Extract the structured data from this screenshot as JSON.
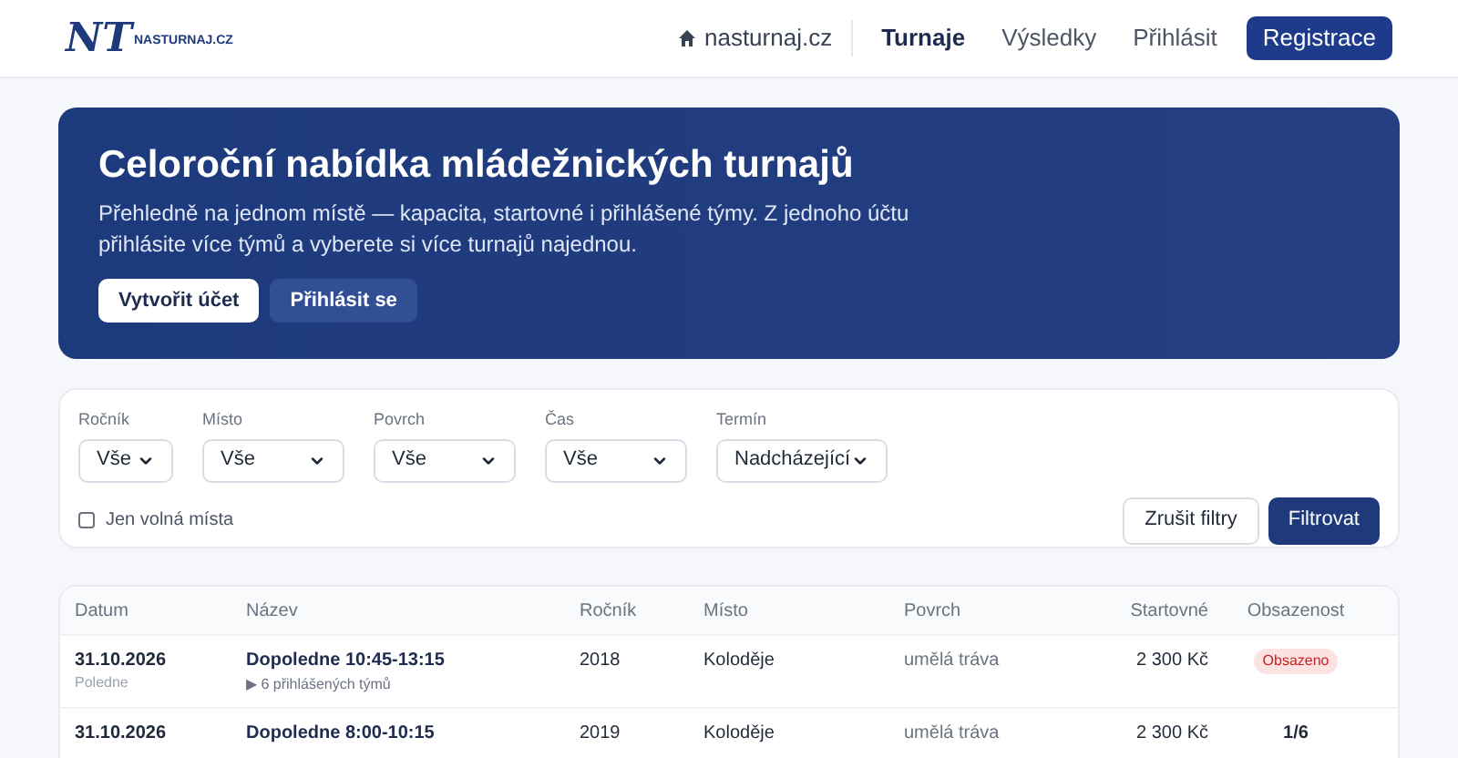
{
  "header": {
    "logo": {
      "mark": "NT",
      "name": "NASTURNAJ.CZ"
    },
    "home_link": "nasturnaj.cz",
    "nav": [
      {
        "label": "Turnaje",
        "selected": true
      },
      {
        "label": "Výsledky",
        "selected": false
      },
      {
        "label": "Přihlásit",
        "selected": false
      }
    ],
    "cta": "Registrace"
  },
  "hero": {
    "title": "Celoroční nabídka mládežnických turnajů",
    "text": "Přehledně na jednom místě — kapacita, startovné i přihlášené týmy. Z jednoho účtu přihlásite více týmů a vyberete si více turnajů najednou.",
    "buttons": [
      {
        "label": "Vytvořit účet",
        "kind": "primary"
      },
      {
        "label": "Přihlásit se",
        "kind": "secondary"
      }
    ]
  },
  "filters": {
    "selects": [
      {
        "label": "Ročník",
        "value": "Vše"
      },
      {
        "label": "Místo",
        "value": "Vše"
      },
      {
        "label": "Povrch",
        "value": "Vše"
      },
      {
        "label": "Čas",
        "value": "Vše"
      },
      {
        "label": "Termín",
        "value": "Nadcházející"
      }
    ],
    "free_only": {
      "label": "Jen volná místa",
      "checked": false
    },
    "reset": "Zrušit filtry",
    "apply": "Filtrovat"
  },
  "table": {
    "columns": [
      "Datum",
      "Název",
      "Ročník",
      "Místo",
      "Povrch",
      "Startovné",
      "Obsazenost"
    ],
    "rows": [
      {
        "date": "31.10.2026",
        "period": "Poledne",
        "name": "Dopoledne 10:45-13:15",
        "teams": "▶ 6 přihlášených týmů",
        "year": "2018",
        "place": "Koloděje",
        "surface": "umělá tráva",
        "fee": "2 300 Kč",
        "capacity": {
          "kind": "badge",
          "text": "Obsazeno"
        }
      },
      {
        "date": "31.10.2026",
        "name": "Dopoledne 8:00-10:15",
        "year": "2019",
        "place": "Koloděje",
        "surface": "umělá tráva",
        "fee": "2 300 Kč",
        "capacity": {
          "kind": "text",
          "text": "1/6"
        }
      }
    ]
  }
}
